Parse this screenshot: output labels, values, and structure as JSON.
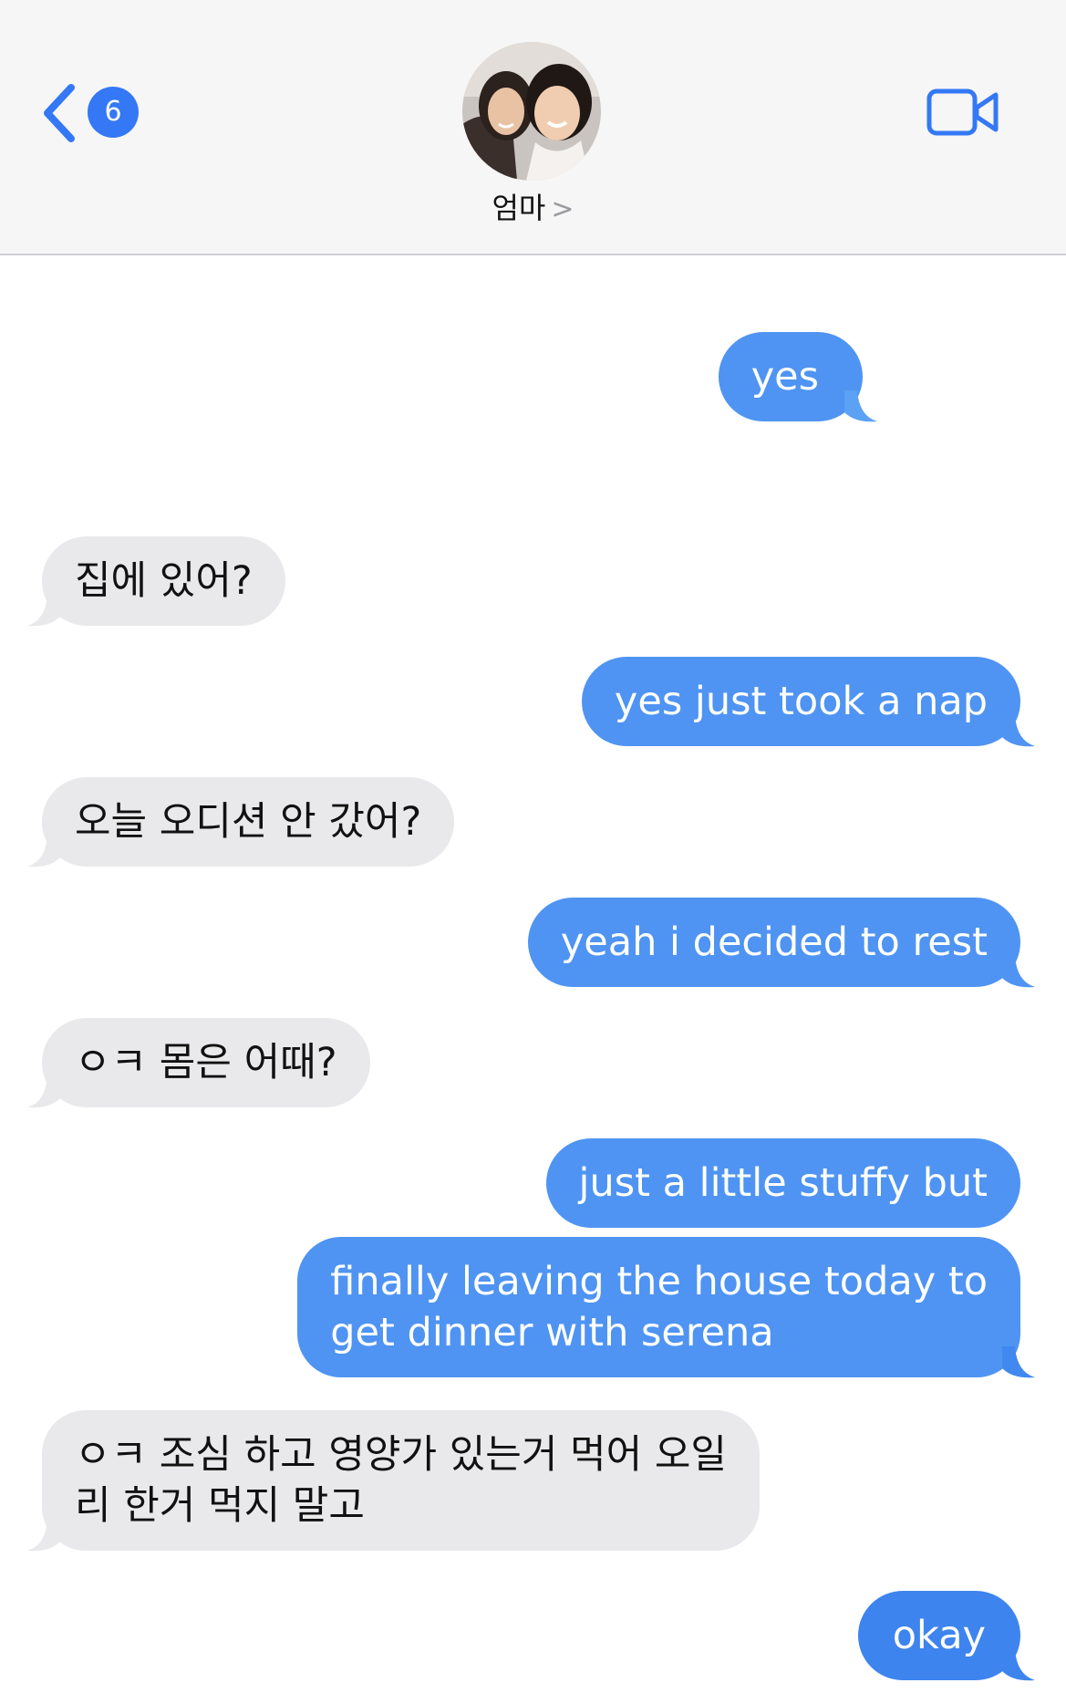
{
  "header": {
    "unread_count": "6",
    "contact_name": "엄마",
    "contact_chevron": ">",
    "video_icon": "video-camera-icon",
    "back_icon": "chevron-left-icon"
  },
  "colors": {
    "accent": "#3478f6",
    "outgoing_bubble": "#4f94f2",
    "incoming_bubble": "#e9e9eb"
  },
  "messages": [
    {
      "direction": "outgoing",
      "text": "yes"
    },
    {
      "direction": "incoming",
      "text": "집에 있어?"
    },
    {
      "direction": "outgoing",
      "text": "yes just took a nap"
    },
    {
      "direction": "incoming",
      "text": "오늘 오디션 안 갔어?"
    },
    {
      "direction": "outgoing",
      "text": "yeah i decided to rest"
    },
    {
      "direction": "incoming",
      "text": "ㅇㅋ 몸은 어때?"
    },
    {
      "direction": "outgoing",
      "text": "just a little stuffy but"
    },
    {
      "direction": "outgoing",
      "lines": [
        "finally leaving the house today to",
        "get dinner with serena"
      ]
    },
    {
      "direction": "incoming",
      "lines": [
        "ㅇㅋ 조심 하고 영양가 있는거 먹어 오일",
        "리 한거 먹지 말고"
      ]
    },
    {
      "direction": "outgoing",
      "text": "okay"
    }
  ]
}
